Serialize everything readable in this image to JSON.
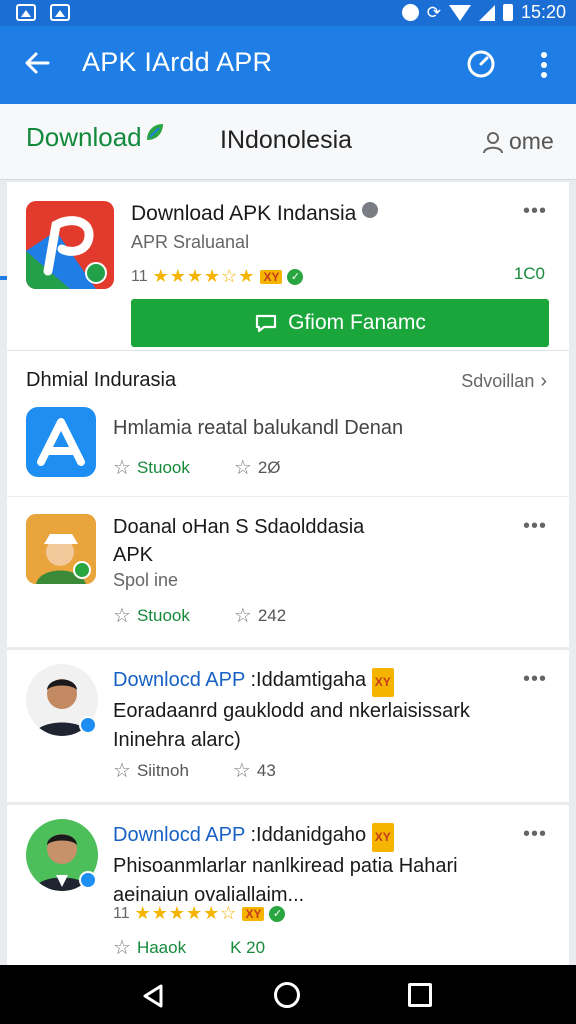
{
  "status_bar": {
    "time": "15:20"
  },
  "app_bar": {
    "title": "APK IArdd APR"
  },
  "tabs": {
    "download": "Download",
    "indonesia": "INdonolesia",
    "home": "ome"
  },
  "featured": {
    "title": "Download APK Indansia",
    "subtitle": "APR Sraluanal",
    "rating_prefix": "11",
    "stars": "★★★★☆★",
    "tag": "XY",
    "size": "1C0",
    "install_label": "Gfiom Fanamc",
    "colors": {
      "install": "#1aa63b",
      "accent": "#1e7ee6"
    }
  },
  "section": {
    "title": "Dhmial Indurasia",
    "more": "Sdvoillan",
    "app": {
      "title": "Hmlamia reatal balukandl Denan",
      "left_meta": "Stuook",
      "right_meta": "2Ø"
    }
  },
  "items": [
    {
      "title": "Doanal oHan S Sdaolddasia",
      "title2": "APK",
      "subtitle": "Spol ine",
      "left_meta": "Stuook",
      "right_meta": "242"
    },
    {
      "head": "Downlocd APP",
      "head_rest": ":Iddamtigaha",
      "line2": "Eoradaanrd gauklodd and nkerlaisissark",
      "line3": "Ininehra alarc)",
      "left_meta": "Siitnoh",
      "right_meta": "43"
    },
    {
      "head": "Downlocd APP",
      "head_rest": ":Iddanidgaho",
      "line2": "Phisoanmlarlar nanlkiread patia Hahari",
      "line3": "aeinaiun ovaliallaim...",
      "rating_prefix": "11",
      "stars": "★★★★★☆",
      "left_meta": "Haaok",
      "right_meta": "K 20"
    }
  ]
}
